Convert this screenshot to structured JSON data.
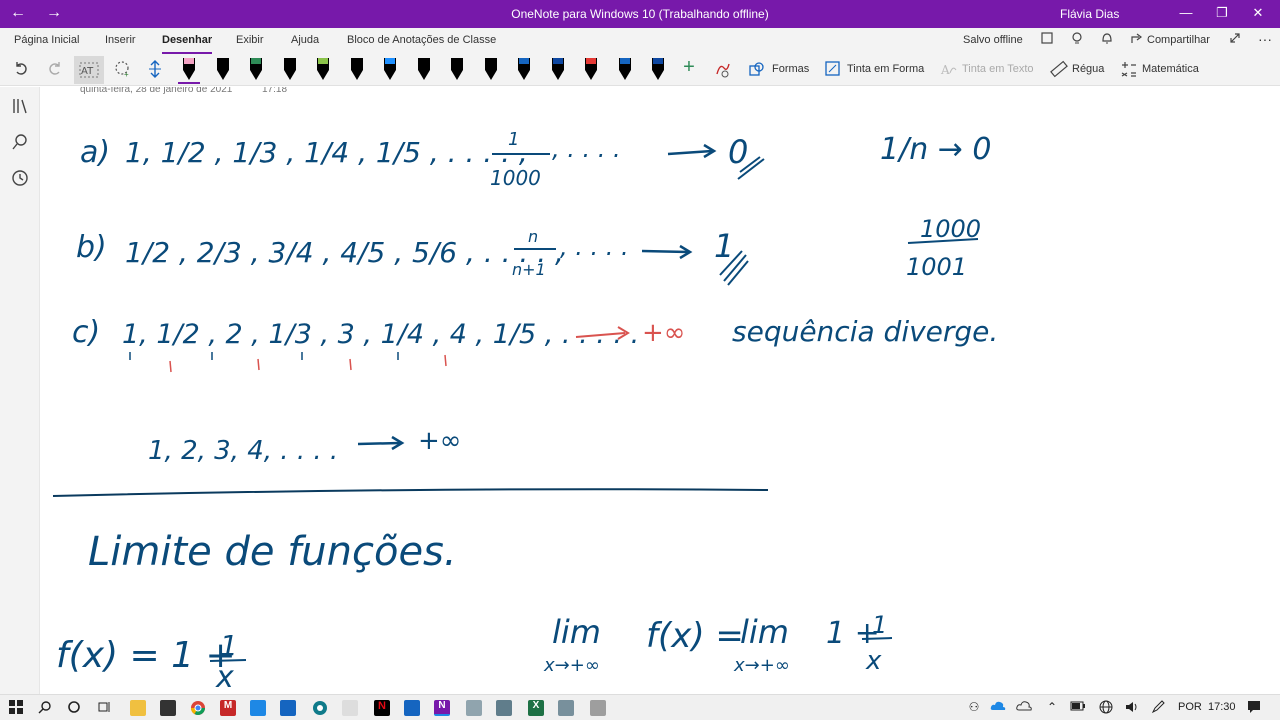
{
  "window": {
    "title": "OneNote para Windows 10 (Trabalhando offline)",
    "user": "Flávia Dias",
    "back": "←",
    "forward": "→",
    "minimize": "—",
    "maximize": "❐",
    "close": "✕"
  },
  "ribbon": {
    "tabs": [
      "Página Inicial",
      "Inserir",
      "Desenhar",
      "Exibir",
      "Ajuda",
      "Bloco de Anotações de Classe"
    ],
    "active_tab": "Desenhar",
    "status": "Salvo offline",
    "share": "Compartilhar",
    "more": "···"
  },
  "toolbar": {
    "shapes": "Formas",
    "ink_to_shape": "Tinta em Forma",
    "ink_to_text": "Tinta em Texto",
    "ruler": "Régua",
    "math": "Matemática",
    "add_pen": "+"
  },
  "pens": [
    {
      "color": "#000000",
      "tip": "#f4a3c4"
    },
    {
      "color": "#000000",
      "tip": "#000000"
    },
    {
      "color": "#000000",
      "tip": "#2e8b57"
    },
    {
      "color": "#000000",
      "tip": "#000000"
    },
    {
      "color": "#000000",
      "tip": "#8bc34a"
    },
    {
      "color": "#000000",
      "tip": "#000000"
    },
    {
      "color": "#000000",
      "tip": "#1e90ff"
    },
    {
      "color": "#000000",
      "tip": "#000000"
    },
    {
      "color": "#000000",
      "tip": "#000000"
    },
    {
      "color": "#000000",
      "tip": "#000000"
    },
    {
      "color": "#000000",
      "tip": "#1565c0"
    },
    {
      "color": "#000000",
      "tip": "#0d47a1"
    },
    {
      "color": "#000000",
      "tip": "#e53935"
    },
    {
      "color": "#000000",
      "tip": "#1565c0"
    },
    {
      "color": "#000000",
      "tip": "#0d47a1"
    }
  ],
  "page": {
    "date": "quinta-feira, 28 de janeiro de 2021",
    "time": "17:18"
  },
  "notes": {
    "a_label": "a)",
    "a_seq": "1, 1/2 , 1/3 , 1/4 , 1/5 , . . . . ,",
    "a_frac_num": "1",
    "a_frac_den": "1000",
    "a_dots": ", . . . .",
    "a_limit": "0",
    "a_side": "1/n → 0",
    "b_label": "b)",
    "b_seq": "1/2 , 2/3 , 3/4 , 4/5 , 5/6 , . . . . ,",
    "b_frac_num": "n",
    "b_frac_den": "n+1",
    "b_dots": ", . . . .",
    "b_limit": "1",
    "b_side_num": "1000",
    "b_side_den": "1001",
    "c_label": "c)",
    "c_seq": "1, 1/2 , 2 , 1/3 , 3 , 1/4 , 4 , 1/5 , . . . . .",
    "c_limit": "+∞",
    "c_note": "sequência diverge.",
    "d_seq": "1, 2, 3, 4, . . . .",
    "d_limit": "+∞",
    "heading": "Limite de funções.",
    "f_def": "f(x) = 1 +",
    "f_num": "1",
    "f_den": "x",
    "lim_word": "lim",
    "lim_sub": "x→+∞",
    "lim_fx": "f(x) =",
    "lim_word2": "lim",
    "lim_sub2": "x→+∞",
    "lim_rhs": "1 +",
    "lim_num": "1",
    "lim_den": "x"
  },
  "tray": {
    "language": "POR",
    "clock": "17:30"
  }
}
